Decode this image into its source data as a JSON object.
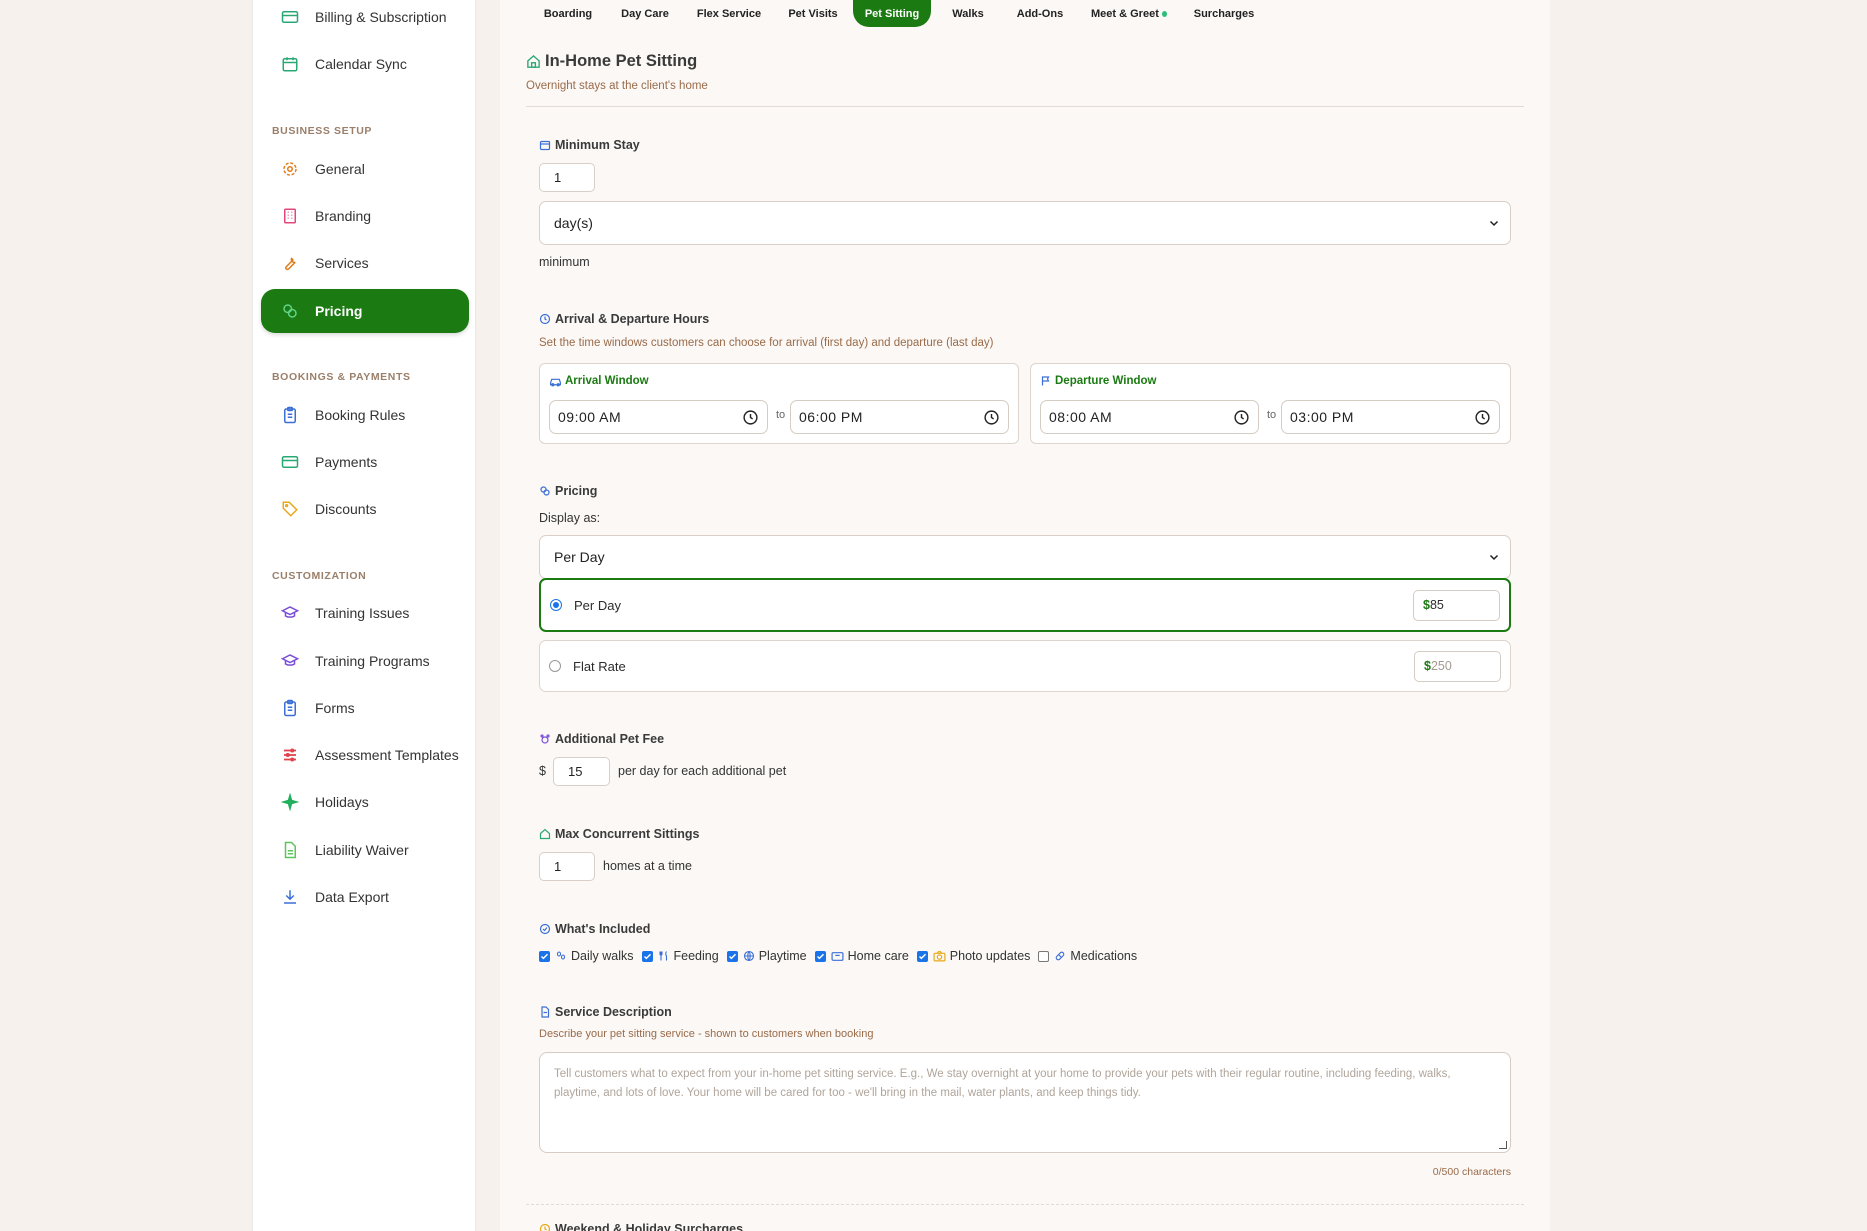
{
  "sidebar": {
    "items_top": [
      {
        "label": "Billing & Subscription",
        "icon": "credit-card-icon"
      },
      {
        "label": "Calendar Sync",
        "icon": "calendar-icon"
      }
    ],
    "section_business": "BUSINESS SETUP",
    "business_items": [
      {
        "label": "General",
        "icon": "gear-icon"
      },
      {
        "label": "Branding",
        "icon": "building-icon"
      },
      {
        "label": "Services",
        "icon": "wrench-icon"
      },
      {
        "label": "Pricing",
        "icon": "coins-icon",
        "active": true
      }
    ],
    "section_bookings": "BOOKINGS & PAYMENTS",
    "booking_items": [
      {
        "label": "Booking Rules",
        "icon": "clipboard-icon"
      },
      {
        "label": "Payments",
        "icon": "credit-card-icon"
      },
      {
        "label": "Discounts",
        "icon": "tag-icon"
      }
    ],
    "section_custom": "CUSTOMIZATION",
    "custom_items": [
      {
        "label": "Training Issues",
        "icon": "graduation-cap-icon"
      },
      {
        "label": "Training Programs",
        "icon": "graduation-cap-icon"
      },
      {
        "label": "Forms",
        "icon": "clipboard-icon"
      },
      {
        "label": "Assessment Templates",
        "icon": "list-icon"
      },
      {
        "label": "Holidays",
        "icon": "sparkle-icon"
      },
      {
        "label": "Liability Waiver",
        "icon": "document-icon"
      },
      {
        "label": "Data Export",
        "icon": "download-icon"
      }
    ]
  },
  "tabs": [
    {
      "label": "Boarding"
    },
    {
      "label": "Day Care"
    },
    {
      "label": "Flex Service"
    },
    {
      "label": "Pet Visits"
    },
    {
      "label": "Pet Sitting",
      "active": true
    },
    {
      "label": "Walks"
    },
    {
      "label": "Add-Ons"
    },
    {
      "label": "Meet & Greet"
    },
    {
      "label": "Surcharges"
    }
  ],
  "page": {
    "title": "In-Home Pet Sitting",
    "subtitle": "Overnight stays at the client's home"
  },
  "min_stay": {
    "label": "Minimum Stay",
    "value": "1",
    "unit": "day(s)",
    "suffix": "minimum"
  },
  "hours": {
    "label": "Arrival & Departure Hours",
    "hint": "Set the time windows customers can choose for arrival (first day) and departure (last day)",
    "arrival_label": "Arrival Window",
    "arrival_from": "09:00 AM",
    "arrival_to": "06:00 PM",
    "departure_label": "Departure Window",
    "departure_from": "08:00 AM",
    "departure_to": "03:00 PM",
    "to": "to"
  },
  "pricing": {
    "label": "Pricing",
    "display_as": "Display as:",
    "display_value": "Per Day",
    "per_day_label": "Per Day",
    "per_day_currency": "$",
    "per_day_value": "85",
    "flat_label": "Flat Rate",
    "flat_currency": "$",
    "flat_placeholder": "250"
  },
  "additional_fee": {
    "label": "Additional Pet Fee",
    "currency": "$",
    "value": "15",
    "suffix": "per day for each additional pet"
  },
  "max_sittings": {
    "label": "Max Concurrent Sittings",
    "value": "1",
    "suffix": "homes at a time"
  },
  "included": {
    "label": "What's Included",
    "items": [
      {
        "label": "Daily walks",
        "checked": true,
        "icon": "paw-icon"
      },
      {
        "label": "Feeding",
        "checked": true,
        "icon": "utensils-icon"
      },
      {
        "label": "Playtime",
        "checked": true,
        "icon": "globe-icon"
      },
      {
        "label": "Home care",
        "checked": true,
        "icon": "home-card-icon"
      },
      {
        "label": "Photo updates",
        "checked": true,
        "icon": "camera-icon"
      },
      {
        "label": "Medications",
        "checked": false,
        "icon": "pill-icon"
      }
    ]
  },
  "description": {
    "label": "Service Description",
    "hint": "Describe your pet sitting service - shown to customers when booking",
    "placeholder": "Tell customers what to expect from your in-home pet sitting service. E.g., We stay overnight at your home to provide your pets with their regular routine, including feeding, walks, playtime, and lots of love. Your home will be cared for too - we'll bring in the mail, water plants, and keep things tidy.",
    "counter": "0/500 characters"
  },
  "next_section": {
    "label": "Weekend & Holiday Surcharges"
  }
}
